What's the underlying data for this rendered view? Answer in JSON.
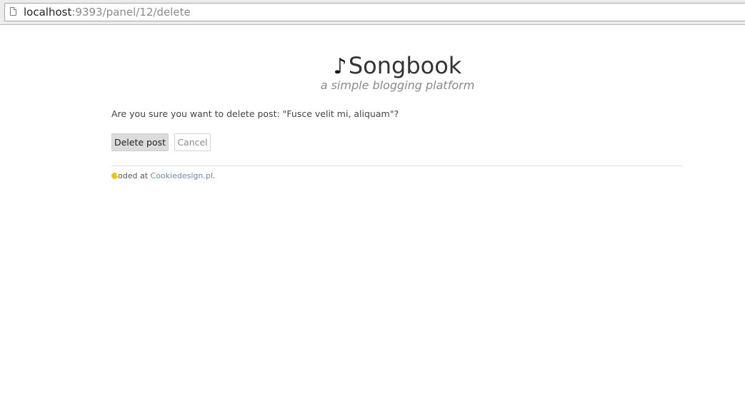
{
  "browser": {
    "url_host": "localhost",
    "url_path": ":9393/panel/12/delete"
  },
  "header": {
    "music_icon": "♪",
    "title": "Songbook",
    "tagline": "a simple blogging platform"
  },
  "main": {
    "confirm_text": "Are you sure you want to delete post: \"Fusce velit mi, aliquam\"?",
    "delete_label": "Delete post",
    "cancel_label": "Cancel"
  },
  "footer": {
    "text": "oded at ",
    "link_text": "Cookiedesign.pl",
    "suffix": "."
  },
  "colors": {
    "link": "#6a8aa8",
    "cookie": "#f2c300",
    "delete_button_bg": "#dcdcdc"
  }
}
